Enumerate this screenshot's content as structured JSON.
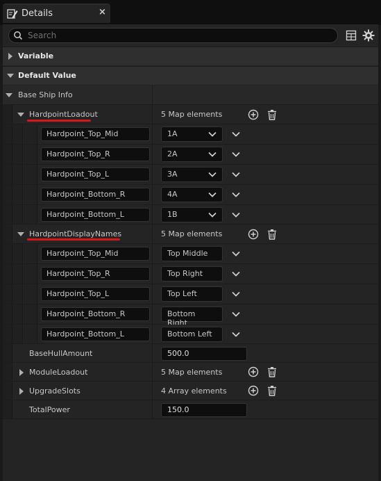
{
  "tab": {
    "title": "Details",
    "close": "×"
  },
  "search": {
    "placeholder": "Search"
  },
  "categories": {
    "variable": "Variable",
    "default_value": "Default Value"
  },
  "base_ship_info": {
    "label": "Base Ship Info"
  },
  "hardpoint_loadout": {
    "label": "HardpointLoadout",
    "summary": "5 Map elements",
    "entries": [
      {
        "key": "Hardpoint_Top_Mid",
        "value": "1A"
      },
      {
        "key": "Hardpoint_Top_R",
        "value": "2A"
      },
      {
        "key": "Hardpoint_Top_L",
        "value": "3A"
      },
      {
        "key": "Hardpoint_Bottom_R",
        "value": "4A"
      },
      {
        "key": "Hardpoint_Bottom_L",
        "value": "1B"
      }
    ]
  },
  "hardpoint_display_names": {
    "label": "HardpointDisplayNames",
    "summary": "5 Map elements",
    "entries": [
      {
        "key": "Hardpoint_Top_Mid",
        "value": "Top Middle"
      },
      {
        "key": "Hardpoint_Top_R",
        "value": "Top Right"
      },
      {
        "key": "Hardpoint_Top_L",
        "value": "Top Left"
      },
      {
        "key": "Hardpoint_Bottom_R",
        "value": "Bottom Right"
      },
      {
        "key": "Hardpoint_Bottom_L",
        "value": "Bottom Left"
      }
    ]
  },
  "base_hull_amount": {
    "label": "BaseHullAmount",
    "value": "500.0"
  },
  "module_loadout": {
    "label": "ModuleLoadout",
    "summary": "5 Map elements"
  },
  "upgrade_slots": {
    "label": "UpgradeSlots",
    "summary": "4 Array elements"
  },
  "total_power": {
    "label": "TotalPower",
    "value": "150.0"
  },
  "colors": {
    "background": "#242424",
    "category": "#2f2f2f",
    "input": "#0e0e0e",
    "annotation_red": "#d81818"
  },
  "icons": {
    "tab": "details-pencil-icon",
    "search": "search-icon",
    "grid": "table-grid-icon",
    "settings": "gear-icon",
    "add": "plus-circle-icon",
    "delete": "trash-icon",
    "expand": "triangle-arrow-icon",
    "dropdown": "chevron-down-icon"
  }
}
